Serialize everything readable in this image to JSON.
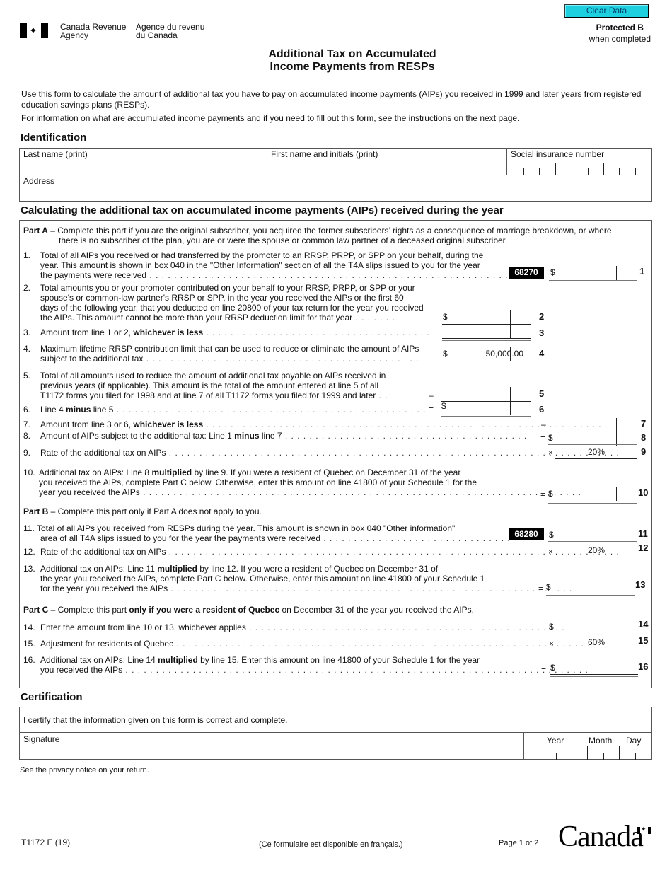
{
  "header": {
    "agency_en_1": "Canada Revenue",
    "agency_en_2": "Agency",
    "agency_fr_1": "Agence du revenu",
    "agency_fr_2": "du Canada",
    "clear_button": "Clear Data",
    "protected_1": "Protected B",
    "protected_2": "when completed",
    "title_1": "Additional Tax on Accumulated",
    "title_2": "Income Payments from RESPs"
  },
  "intro": {
    "p1": "Use this form to calculate the amount of additional tax you have to pay on accumulated income payments (AIPs) you received in 1999 and later years from registered education savings plans (RESPs).",
    "p2": "For information on what are accumulated income payments and if you need to fill out this form, see the instructions on the next page."
  },
  "identification": {
    "heading": "Identification",
    "last_name_label": "Last name (print)",
    "first_name_label": "First name and initials (print)",
    "sin_label": "Social insurance number",
    "address_label": "Address",
    "last_name_value": "",
    "first_name_value": "",
    "sin_value": "",
    "address_value": ""
  },
  "calc": {
    "heading": "Calculating the additional tax on accumulated income payments (AIPs) received during the year",
    "part_a_label": "Part A",
    "part_a_text_1": " – Complete this part if you are the original subscriber, you acquired the former subscribers’ rights as a consequence of marriage breakdown, or where",
    "part_a_text_2": "there is no subscriber of the plan, you are or were the spouse or common law partner of a deceased original subscriber.",
    "part_b_label": "Part B",
    "part_b_text": " – Complete this part only if Part A does not apply to you.",
    "part_c_label": "Part C",
    "part_c_text_1": " – Complete this part ",
    "part_c_bold": "only if you were a resident of Quebec",
    "part_c_text_2": " on December 31 of the year you received the AIPs.",
    "lines": {
      "l1": {
        "n": "1.",
        "t1": "Total of all AIPs you received or had transferred by the promoter to an RRSP, PRPP, or SPP on your behalf, during the",
        "t2": "year. This amount is shown in box 040 in the \"Other Information\" section of all the T4A slips issued to you for the year",
        "t3": "the payments were received",
        "code": "68270",
        "num": "1",
        "value": ""
      },
      "l2": {
        "n": "2.",
        "t1": "Total amounts you or your promoter contributed on your behalf to your RRSP, PRPP, or SPP or your",
        "t2": "spouse's or common-law partner's RRSP or SPP, in the year you received the AIPs or the first 60",
        "t3": "days of the following year, that you deducted on line 20800 of your tax return for the year you received",
        "t4": "the AIPs. This amount cannot be more than your RRSP deduction limit for that year",
        "num": "2",
        "value": ""
      },
      "l3": {
        "n": "3.",
        "t1": "Amount from line 1 or 2, ",
        "b": "whichever is less",
        "num": "3",
        "value": ""
      },
      "l4": {
        "n": "4.",
        "t1": "Maximum lifetime RRSP contribution limit that can be used to reduce or eliminate the amount of AIPs",
        "t2": "subject to the additional tax",
        "num": "4",
        "value": "50,000.00"
      },
      "l5": {
        "n": "5.",
        "t1": "Total of all amounts used to reduce the amount of additional tax payable on AIPs received in",
        "t2": "previous years (if applicable). This amount is the total of the amount entered at line 5 of all",
        "t3": "T1172 forms you filed for 1998 and at line 7 of all T1172 forms you filed for 1999 and later",
        "num": "5",
        "value": ""
      },
      "l6": {
        "n": "6.",
        "t1": "Line 4 ",
        "b": "minus",
        "t2": " line 5",
        "num": "6",
        "value": ""
      },
      "l7": {
        "n": "7.",
        "t1": "Amount from line 3 or 6, ",
        "b": "whichever is less",
        "num": "7",
        "value": ""
      },
      "l8": {
        "n": "8.",
        "t1": "Amount of AIPs subject to the additional tax: Line 1 ",
        "b": "minus",
        "t2": " line 7",
        "num": "8",
        "value": ""
      },
      "l9": {
        "n": "9.",
        "t1": "Rate of the additional tax on AIPs",
        "num": "9",
        "value": "20%"
      },
      "l10": {
        "n": "10.",
        "t1a": "Additional tax on AIPs: Line 8 ",
        "b": "multiplied",
        "t1b": " by line 9. If you were a resident of Quebec on December 31 of the year",
        "t2": "you received the AIPs, complete Part C below. Otherwise, enter this amount on line 41800 of your Schedule 1 for the",
        "t3": "year you received the AIPs",
        "num": "10",
        "value": ""
      },
      "l11": {
        "n": "11.",
        "t1": "Total of all AIPs you received from RESPs during the year. This amount is shown in box 040 \"Other information\"",
        "t2": "area of all T4A slips issued to you for the year the payments were received",
        "code": "68280",
        "num": "11",
        "value": ""
      },
      "l12": {
        "n": "12.",
        "t1": "Rate of the additional tax on AIPs",
        "num": "12",
        "value": "20%"
      },
      "l13": {
        "n": "13.",
        "t1a": "Additional tax on AIPs: Line 11 ",
        "b": "multiplied",
        "t1b": " by line 12. If you were a resident of Quebec on December 31 of",
        "t2": "the year you received the AIPs, complete Part C below. Otherwise, enter this amount on line 41800 of your Schedule 1",
        "t3": "for the year you received the AIPs",
        "num": "13",
        "value": ""
      },
      "l14": {
        "n": "14.",
        "t1": "Enter the amount from line 10 or 13, whichever applies",
        "num": "14",
        "value": ""
      },
      "l15": {
        "n": "15.",
        "t1": "Adjustment for residents of Quebec",
        "num": "15",
        "value": "60%"
      },
      "l16": {
        "n": "16.",
        "t1a": "Additional tax on AIPs: Line 14 ",
        "b": "multiplied",
        "t1b": " by line 15. Enter this amount on line 41800 of your Schedule 1 for the year",
        "t2": "you received the AIPs",
        "num": "16",
        "value": ""
      }
    },
    "symbols": {
      "dollar": "$",
      "minus": "–",
      "equals": "=",
      "times": "×"
    }
  },
  "certification": {
    "heading": "Certification",
    "statement": "I certify that the information given on this form is correct and complete.",
    "signature_label": "Signature",
    "year_label": "Year",
    "month_label": "Month",
    "day_label": "Day"
  },
  "footer": {
    "privacy": "See the privacy notice on your return.",
    "form_id": "T1172 E (19)",
    "french": "(Ce formulaire est disponible en français.)",
    "page": "Page 1 of 2",
    "wordmark": "Canada"
  }
}
